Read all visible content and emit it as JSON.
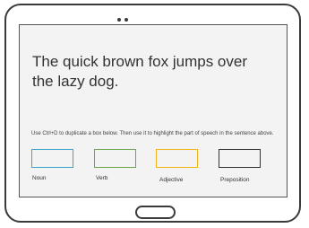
{
  "device": {
    "camera_dots": [
      "camera-dot-1",
      "camera-dot-2"
    ],
    "home_button_icon": "rounded-rectangle"
  },
  "slide": {
    "sentence": "The quick brown fox jumps over the lazy dog.",
    "instructions": "Use Ctrl+D to duplicate a box below. Then use it to highlight the part of speech in the sentence above.",
    "parts_of_speech": [
      {
        "label": "Noun",
        "color": "#3aa6c8"
      },
      {
        "label": "Verb",
        "color": "#6aa84f"
      },
      {
        "label": "Adjective",
        "color": "#f1b51c"
      },
      {
        "label": "Preposition",
        "color": "#333333"
      }
    ]
  }
}
